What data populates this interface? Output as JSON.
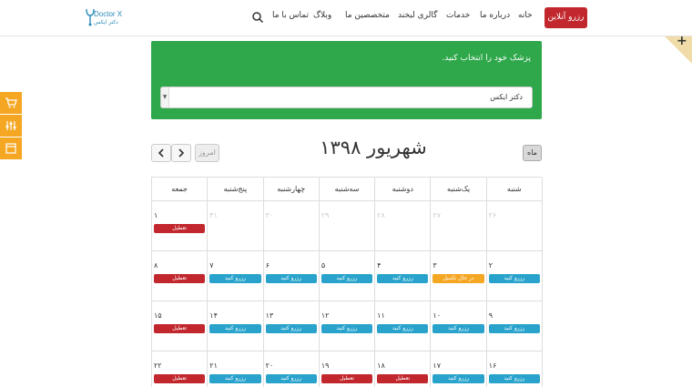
{
  "header": {
    "logo_mark": "𐑥",
    "logo_text": "Doctor X",
    "logo_sub": "دکتر ایکس",
    "nav": [
      {
        "label": "خانه",
        "name": "nav-home"
      },
      {
        "label": "درباره ما",
        "name": "nav-about"
      },
      {
        "label": "خدمات",
        "name": "nav-services"
      },
      {
        "label": "گالری لبخند",
        "name": "nav-gallery"
      },
      {
        "label": "متخصصین ما",
        "name": "nav-specialists"
      },
      {
        "label": "وبلاگ",
        "name": "nav-blog"
      },
      {
        "label": "تماس با ما",
        "name": "nav-contact"
      }
    ],
    "reserve_button": "رزرو آنلاین",
    "corner_plus": "+"
  },
  "side_icons": [
    "cart-icon",
    "sliders-icon",
    "layout-icon"
  ],
  "doctor_panel": {
    "label": "پزشک خود را انتخاب کنید.",
    "selected": "دکتر ایکس"
  },
  "calendar": {
    "title": "شهریور ۱۳۹۸",
    "today_label": "امروز",
    "month_label": "ماه",
    "weekdays": [
      "شنبه",
      "یک‌شنبه",
      "دوشنبه",
      "سه‌شنبه",
      "چهارشنبه",
      "پنج‌شنبه",
      "جمعه"
    ],
    "weeks": [
      [
        {
          "day": "۲۶",
          "other": true
        },
        {
          "day": "۲۷",
          "other": true
        },
        {
          "day": "۲۸",
          "other": true
        },
        {
          "day": "۲۹",
          "other": true
        },
        {
          "day": "۳۰",
          "other": true
        },
        {
          "day": "۳۱",
          "other": true
        },
        {
          "day": "۱",
          "badge": "holiday",
          "badge_label": "تعطیل"
        }
      ],
      [
        {
          "day": "۲",
          "badge": "reserve",
          "badge_label": "رزرو کنید"
        },
        {
          "day": "۳",
          "badge": "pending",
          "badge_label": "در حال تکمیل"
        },
        {
          "day": "۴",
          "badge": "reserve",
          "badge_label": "رزرو کنید"
        },
        {
          "day": "۵",
          "badge": "reserve",
          "badge_label": "رزرو کنید"
        },
        {
          "day": "۶",
          "badge": "reserve",
          "badge_label": "رزرو کنید"
        },
        {
          "day": "۷",
          "badge": "reserve",
          "badge_label": "رزرو کنید"
        },
        {
          "day": "۸",
          "badge": "holiday",
          "badge_label": "تعطیل"
        }
      ],
      [
        {
          "day": "۹",
          "badge": "reserve",
          "badge_label": "رزرو کنید"
        },
        {
          "day": "۱۰",
          "badge": "reserve",
          "badge_label": "رزرو کنید"
        },
        {
          "day": "۱۱",
          "badge": "reserve",
          "badge_label": "رزرو کنید"
        },
        {
          "day": "۱۲",
          "badge": "reserve",
          "badge_label": "رزرو کنید"
        },
        {
          "day": "۱۳",
          "badge": "reserve",
          "badge_label": "رزرو کنید"
        },
        {
          "day": "۱۴",
          "badge": "reserve",
          "badge_label": "رزرو کنید"
        },
        {
          "day": "۱۵",
          "badge": "holiday",
          "badge_label": "تعطیل"
        }
      ],
      [
        {
          "day": "۱۶",
          "badge": "reserve",
          "badge_label": "رزرو کنید"
        },
        {
          "day": "۱۷",
          "badge": "reserve",
          "badge_label": "رزرو کنید"
        },
        {
          "day": "۱۸",
          "badge": "holiday",
          "badge_label": "تعطیل"
        },
        {
          "day": "۱۹",
          "badge": "holiday",
          "badge_label": "تعطیل"
        },
        {
          "day": "۲۰",
          "badge": "reserve",
          "badge_label": "رزرو کنید"
        },
        {
          "day": "۲۱",
          "badge": "reserve",
          "badge_label": "رزرو کنید"
        },
        {
          "day": "۲۲",
          "badge": "holiday",
          "badge_label": "تعطیل"
        }
      ]
    ]
  },
  "colors": {
    "brand_red": "#c1272d",
    "panel_green": "#2ea84a",
    "reserve_blue": "#29a3cc",
    "pending_orange": "#f5a623",
    "side_orange": "#f5a623"
  }
}
